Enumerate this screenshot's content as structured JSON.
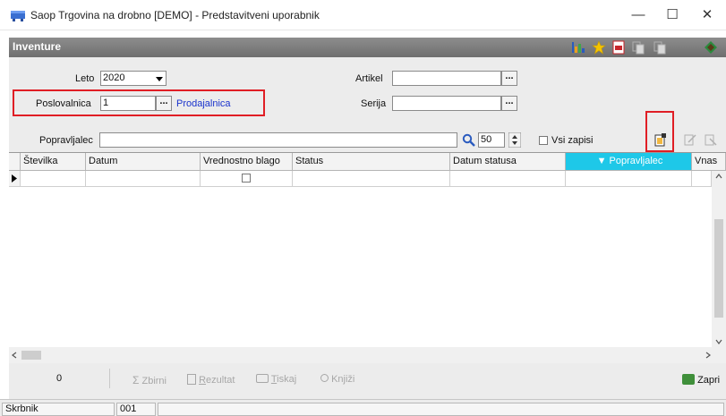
{
  "window": {
    "title": "Saop Trgovina na drobno [DEMO] - Predstavitveni uporabnik",
    "minimize": "—",
    "maximize": "☐",
    "close": "✕"
  },
  "header": {
    "title": "Inventure"
  },
  "form": {
    "leto_label": "Leto",
    "leto_value": "2020",
    "poslovalnica_label": "Poslovalnica",
    "poslovalnica_value": "1",
    "poslovalnica_name": "Prodajalnica",
    "artikel_label": "Artikel",
    "artikel_value": "",
    "serija_label": "Serija",
    "serija_value": "",
    "lookup_dots": "..."
  },
  "toolbar": {
    "popravljalec_label": "Popravljalec",
    "popravljalec_value": "",
    "count_value": "50",
    "vsi_zapisi_label": "Vsi zapisi"
  },
  "grid": {
    "columns": [
      "Številka",
      "Datum",
      "Vrednostno blago",
      "Status",
      "Datum statusa",
      "▼ Popravljalec",
      "Vnas"
    ]
  },
  "footer": {
    "count": "0",
    "zbirni": "Zbirni",
    "rezultat_u": "R",
    "rezultat_rest": "ezultat",
    "tiskaj_u": "T",
    "tiskaj_rest": "iskaj",
    "knjizi": "Knjiži",
    "zapri": "Zapri"
  },
  "statusbar": {
    "user_label": "Skrbnik",
    "code": "001"
  },
  "colors": {
    "header_bg": "#7d7d7d",
    "selected_column": "#1ec8e8",
    "highlight_box": "#e01e25",
    "link": "#1a33cc"
  }
}
